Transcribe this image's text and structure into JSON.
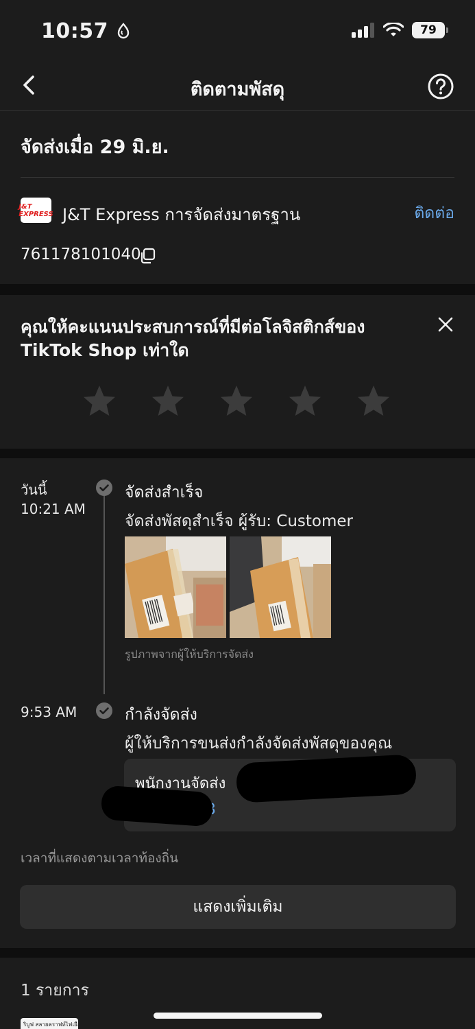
{
  "status_bar": {
    "time": "10:57",
    "battery": "79"
  },
  "nav": {
    "title": "ติดตามพัสดุ"
  },
  "shipment": {
    "ship_date": "จัดส่งเมื่อ 29 มิ.ย.",
    "carrier_logo": "J&T EXPRESS",
    "carrier_name": "J&T Express การจัดส่งมาตรฐาน",
    "contact_label": "ติดต่อ",
    "tracking_number": "761178101040"
  },
  "rating": {
    "question": "คุณให้คะแนนประสบการณ์ที่มีต่อโลจิสติกส์ของ TikTok Shop เท่าใด",
    "stars": 5
  },
  "timeline": {
    "events": [
      {
        "date": "วันนี้",
        "time": "10:21 AM",
        "title": "จัดส่งสำเร็จ",
        "description": "จัดส่งพัสดุสำเร็จ ผู้รับ: Customer",
        "photo_caption": "รูปภาพจากผู้ให้บริการจัดส่ง"
      },
      {
        "time": "9:53 AM",
        "title": "กำลังจัดส่ง",
        "description": "ผู้ให้บริการขนส่งกำลังจัดส่งพัสดุของคุณ",
        "courier_label": "พนักงานจัดส่ง",
        "courier_phone": "423"
      }
    ],
    "timezone_note": "เวลาที่แสดงตามเวลาท้องถิ่น",
    "show_more_label": "แสดงเพิ่มเติม"
  },
  "items": {
    "count_label": "1 รายการ",
    "thumb_text": "ริบูฟ สลายคราฟท์ไฟเยือก"
  },
  "colors": {
    "link": "#6aa8e8",
    "card": "#1c1c1c",
    "background": "#0e0e0e"
  }
}
